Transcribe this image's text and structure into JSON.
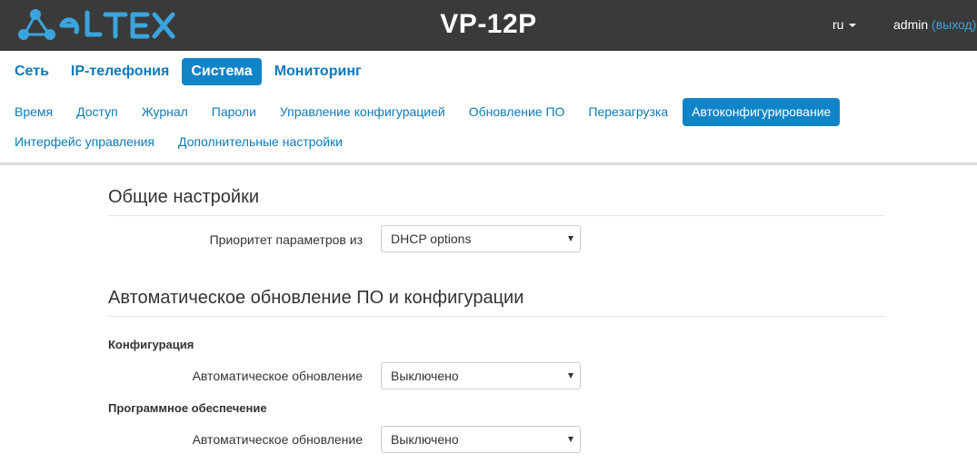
{
  "header": {
    "logo_text": "ELTEX",
    "device": "VP-12P",
    "lang": "ru",
    "user": "admin",
    "logout": "(выход)"
  },
  "colors": {
    "header_bg": "#3a3a3a",
    "accent": "#1184c7",
    "link": "#0c7ab8",
    "logo": "#3aa4de"
  },
  "main_nav": {
    "items": [
      {
        "label": "Сеть"
      },
      {
        "label": "IP-телефония"
      },
      {
        "label": "Система",
        "active": true
      },
      {
        "label": "Мониторинг"
      }
    ]
  },
  "sub_nav": {
    "items": [
      {
        "label": "Время"
      },
      {
        "label": "Доступ"
      },
      {
        "label": "Журнал"
      },
      {
        "label": "Пароли"
      },
      {
        "label": "Управление конфигурацией"
      },
      {
        "label": "Обновление ПО"
      },
      {
        "label": "Перезагрузка"
      },
      {
        "label": "Автоконфигурирование",
        "active": true
      },
      {
        "label": "Интерфейс управления"
      },
      {
        "label": "Дополнительные настройки"
      }
    ]
  },
  "general": {
    "title": "Общие настройки",
    "priority_label": "Приоритет параметров из",
    "priority_value": "DHCP options"
  },
  "auto_update": {
    "title": "Автоматическое обновление ПО и конфигурации",
    "config_title": "Конфигурация",
    "config_label": "Автоматическое обновление",
    "config_value": "Выключено",
    "software_title": "Программное обеспечение",
    "software_label": "Автоматическое обновление",
    "software_value": "Выключено"
  }
}
